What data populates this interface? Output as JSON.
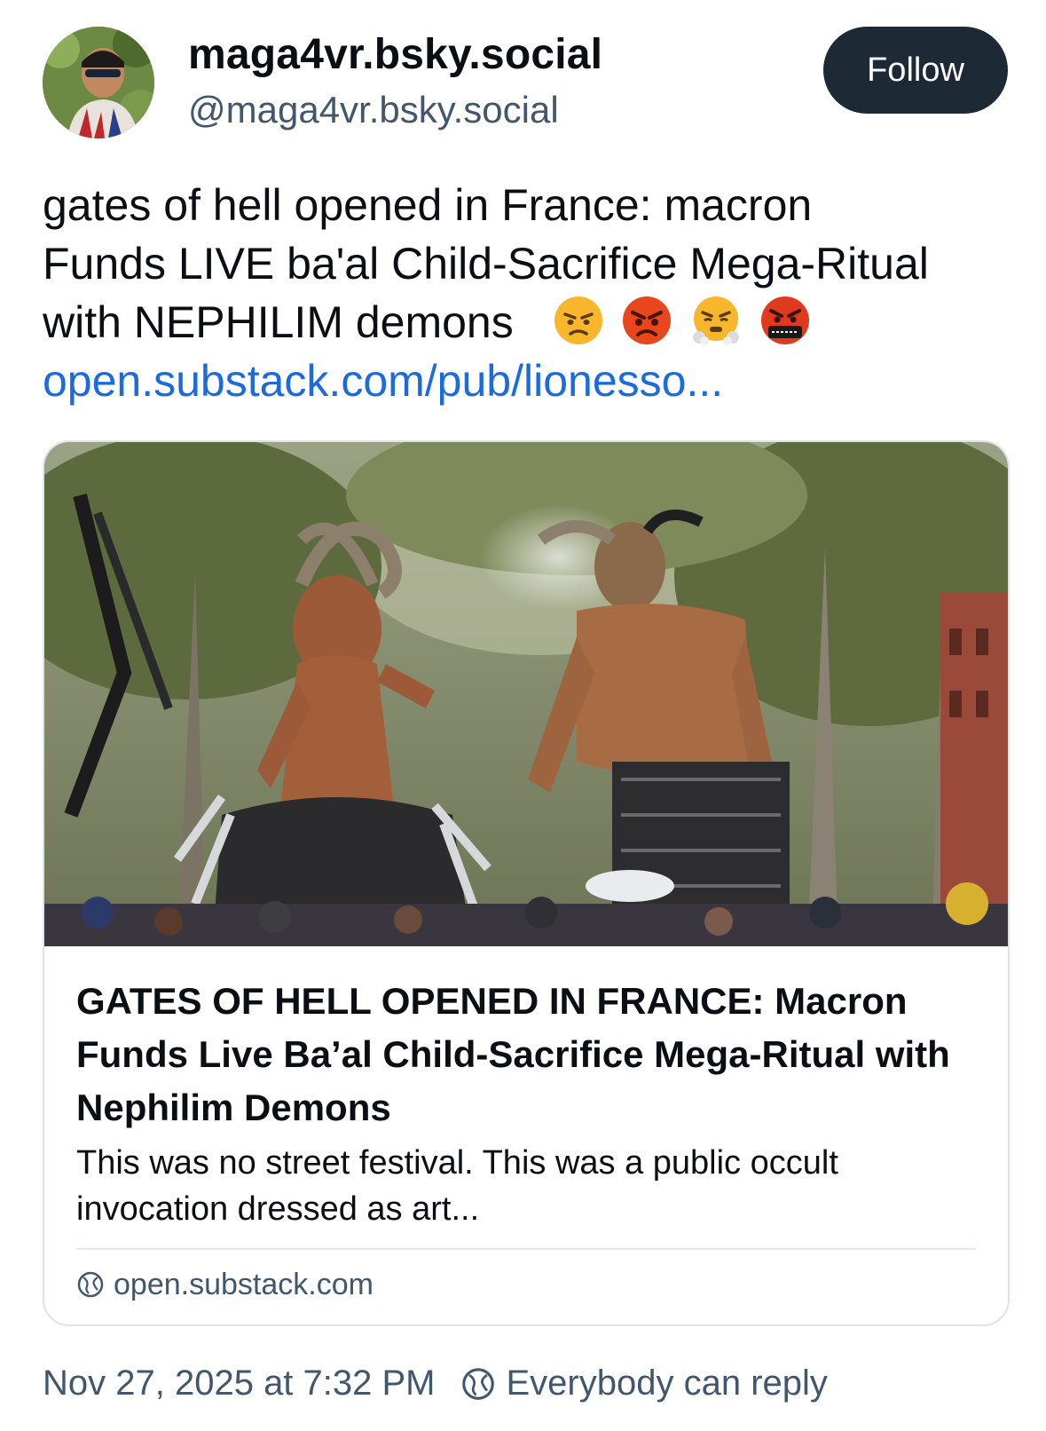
{
  "author": {
    "display_name": "maga4vr.bsky.social",
    "handle": "@maga4vr.bsky.social",
    "avatar": "avatar-photo"
  },
  "follow_button": {
    "label": "Follow"
  },
  "post": {
    "lines": [
      "gates of hell opened  in France: macron",
      "Funds LIVE ba'al Child-Sacrifice Mega-Ritual",
      "with NEPHILIM demons"
    ],
    "emojis": [
      "unamused-angry-face",
      "pouting-face",
      "face-with-steam",
      "face-with-symbols"
    ],
    "link_text": "open.substack.com/pub/lionesso..."
  },
  "link_card": {
    "image": "two giant mechanical horned figures in a tree-lined street parade",
    "title": "GATES OF HELL OPENED IN FRANCE: Macron Funds Live Ba’al Child-Sacrifice Mega-Ritual with Nephilim Demons",
    "description": "This was no street festival. This was a public occult invocation dressed as art...",
    "domain": "open.substack.com"
  },
  "footer": {
    "timestamp": "Nov 27, 2025 at 7:32 PM",
    "reply_setting": "Everybody can reply"
  },
  "colors": {
    "text": "#0b0f14",
    "muted": "#42576c",
    "link": "#1a6ae0",
    "follow_bg": "#1e2936",
    "border": "#dde3ea"
  }
}
